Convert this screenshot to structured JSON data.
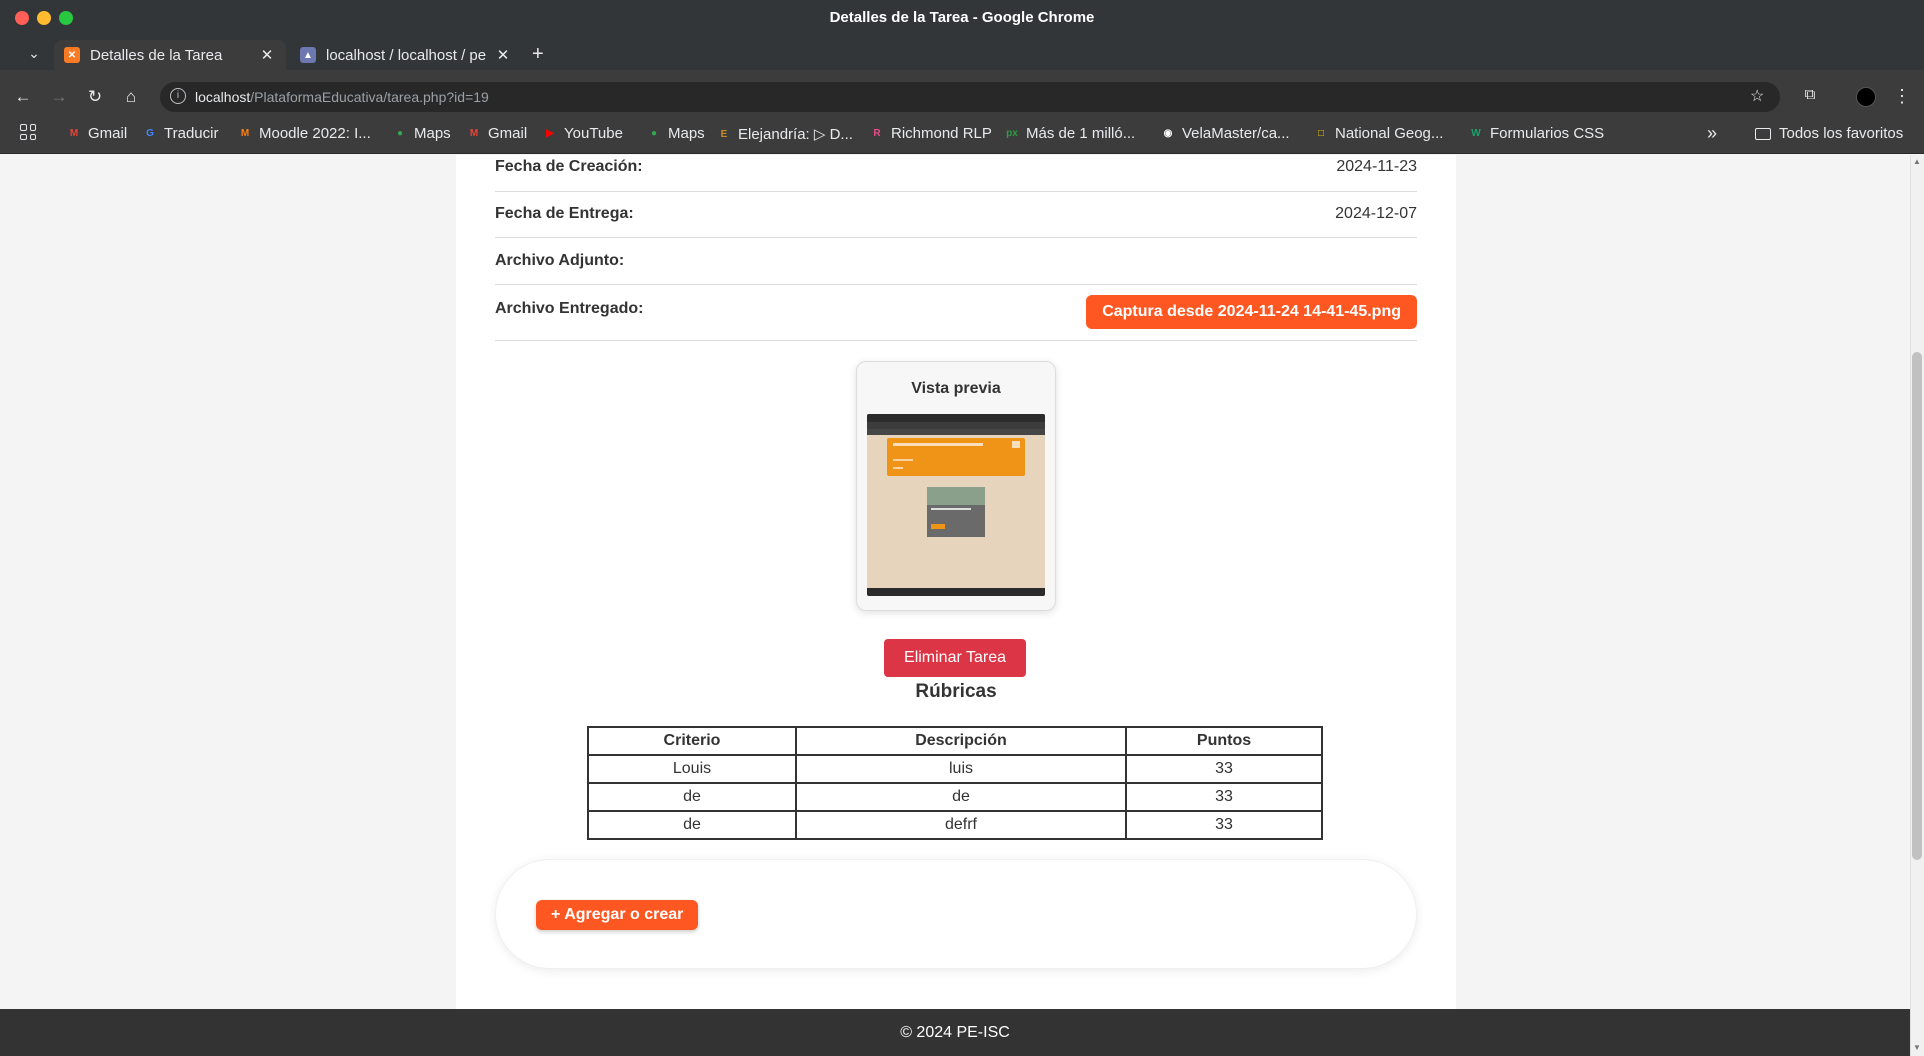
{
  "window": {
    "title": "Detalles de la Tarea - Google Chrome"
  },
  "tabs": [
    {
      "label": "Detalles de la Tarea",
      "icon": "xampp-icon",
      "active": true
    },
    {
      "label": "localhost / localhost / pe",
      "icon": "phpmyadmin-icon",
      "active": false
    }
  ],
  "omnibox": {
    "host": "localhost",
    "path": "/PlataformaEducativa/tarea.php?id=19"
  },
  "bookmarks": [
    {
      "label": "Gmail",
      "icon": "gmail-icon",
      "color": "#ea4335"
    },
    {
      "label": "Traducir",
      "icon": "translate-icon",
      "color": "#4285f4"
    },
    {
      "label": "Moodle 2022: I...",
      "icon": "moodle-icon",
      "color": "#f98012"
    },
    {
      "label": "Maps",
      "icon": "maps-icon",
      "color": "#34a853"
    },
    {
      "label": "Gmail",
      "icon": "gmail-icon",
      "color": "#ea4335"
    },
    {
      "label": "YouTube",
      "icon": "youtube-icon",
      "color": "#ff0000"
    },
    {
      "label": "Maps",
      "icon": "maps-icon",
      "color": "#34a853"
    },
    {
      "label": "Elejandría: ▷ D...",
      "icon": "book-icon",
      "color": "#c98a2b"
    },
    {
      "label": "Richmond RLP",
      "icon": "richmond-icon",
      "color": "#e84d8a"
    },
    {
      "label": "Más de 1 milló...",
      "icon": "px-icon",
      "color": "#2e9d3f"
    },
    {
      "label": "VelaMaster/ca...",
      "icon": "github-icon",
      "color": "#ffffff"
    },
    {
      "label": "National Geog...",
      "icon": "natgeo-icon",
      "color": "#ffce00"
    },
    {
      "label": "Formularios CSS",
      "icon": "w-icon",
      "color": "#1aa36f"
    }
  ],
  "bookmarks_folder": {
    "label": "Todos los favoritos"
  },
  "details": {
    "fecha_creacion": {
      "label": "Fecha de Creación:",
      "value": "2024-11-23"
    },
    "fecha_entrega": {
      "label": "Fecha de Entrega:",
      "value": "2024-12-07"
    },
    "archivo_adjunto": {
      "label": "Archivo Adjunto:",
      "value": ""
    },
    "archivo_entregado": {
      "label": "Archivo Entregado:",
      "file": "Captura desde 2024-11-24 14-41-45.png"
    }
  },
  "preview": {
    "title": "Vista previa"
  },
  "actions": {
    "delete_label": "Eliminar Tarea",
    "add_label": "+ Agregar o crear"
  },
  "rubricas": {
    "title": "Rúbricas",
    "headers": [
      "Criterio",
      "Descripción",
      "Puntos"
    ],
    "rows": [
      [
        "Louis",
        "luis",
        "33"
      ],
      [
        "de",
        "de",
        "33"
      ],
      [
        "de",
        "defrf",
        "33"
      ]
    ]
  },
  "footer": {
    "text": "© 2024 PE-ISC"
  },
  "colors": {
    "accent": "#ff5722",
    "danger": "#dc3545",
    "footer": "#333333"
  }
}
